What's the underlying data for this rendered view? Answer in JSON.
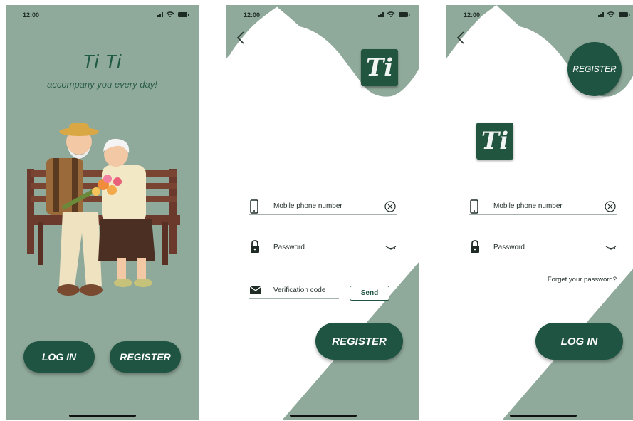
{
  "status": {
    "time": "12:00"
  },
  "screen1": {
    "title": "Ti Ti",
    "tagline": "accompany you every day!",
    "login_label": "LOG IN",
    "register_label": "REGISTER"
  },
  "screen2": {
    "logo_text": "Ti",
    "phone_placeholder": "Mobile phone number",
    "password_placeholder": "Password",
    "verification_placeholder": "Verification code",
    "send_label": "Send",
    "register_label": "REGISTER"
  },
  "screen3": {
    "logo_text": "Ti",
    "register_label": "REGISTER",
    "phone_placeholder": "Mobile phone number",
    "password_placeholder": "Password",
    "forgot_label": "Forget your password?",
    "login_label": "LOG IN"
  },
  "colors": {
    "sage": "#8fa99a",
    "dark_green": "#1f5443",
    "white": "#ffffff"
  }
}
